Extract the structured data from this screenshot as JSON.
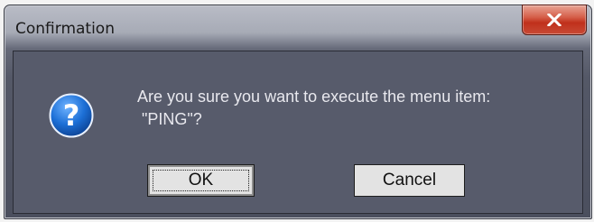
{
  "dialog": {
    "title": "Confirmation",
    "message_line1": "Are you sure you want to execute the menu item:",
    "message_line2": " \"PING\"?",
    "icon": "question-icon",
    "close_icon": "close-icon",
    "buttons": {
      "ok_label": "OK",
      "cancel_label": "Cancel"
    }
  }
}
